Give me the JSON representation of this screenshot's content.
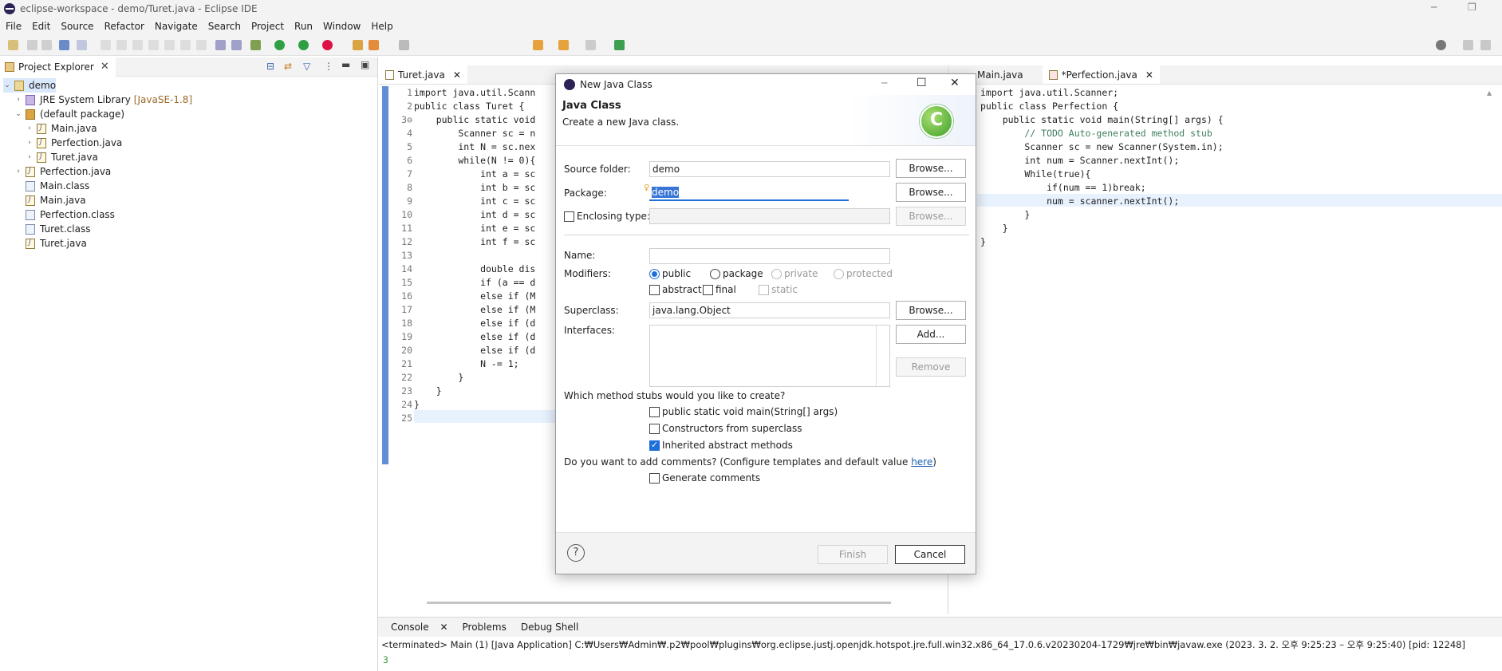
{
  "window": {
    "title": "eclipse-workspace - demo/Turet.java - Eclipse IDE",
    "minimize": "─",
    "maximize": "❐"
  },
  "menu": [
    "File",
    "Edit",
    "Source",
    "Refactor",
    "Navigate",
    "Search",
    "Project",
    "Run",
    "Window",
    "Help"
  ],
  "explorer": {
    "tab": "Project Explorer",
    "tree": [
      {
        "label": "demo",
        "icon": "project-icon",
        "twisty": "⌄",
        "indent": 0
      },
      {
        "label": "JRE System Library",
        "suffix": "[JavaSE-1.8]",
        "icon": "library-icon",
        "twisty": "›",
        "indent": 1
      },
      {
        "label": "(default package)",
        "icon": "package-icon",
        "twisty": "⌄",
        "indent": 1
      },
      {
        "label": "Main.java",
        "icon": "java-file-icon",
        "twisty": "›",
        "indent": 2
      },
      {
        "label": "Perfection.java",
        "icon": "java-file-icon",
        "twisty": "›",
        "indent": 2
      },
      {
        "label": "Turet.java",
        "icon": "java-file-icon",
        "twisty": "›",
        "indent": 2
      },
      {
        "label": "Perfection.java",
        "icon": "java-file-icon",
        "twisty": "›",
        "indent": 1
      },
      {
        "label": "Main.class",
        "icon": "class-file-icon",
        "twisty": "",
        "indent": 1
      },
      {
        "label": "Main.java",
        "icon": "java-file-icon",
        "twisty": "",
        "indent": 1
      },
      {
        "label": "Perfection.class",
        "icon": "class-file-icon",
        "twisty": "",
        "indent": 1
      },
      {
        "label": "Turet.class",
        "icon": "class-file-icon",
        "twisty": "",
        "indent": 1
      },
      {
        "label": "Turet.java",
        "icon": "java-file-icon",
        "twisty": "",
        "indent": 1
      }
    ]
  },
  "editor_left": {
    "tab": "Turet.java",
    "line_numbers": [
      "1",
      "2",
      "3⊖",
      "4",
      "5",
      "6",
      "7",
      "8",
      "9",
      "10",
      "11",
      "12",
      "13",
      "14",
      "15",
      "16",
      "17",
      "18",
      "19",
      "20",
      "21",
      "22",
      "23",
      "24",
      "25"
    ],
    "lines": [
      "import java.util.Scann",
      "public class Turet {",
      "    public static void",
      "        Scanner sc = n",
      "        int N = sc.nex",
      "        while(N != 0){",
      "            int a = sc",
      "            int b = sc",
      "            int c = sc",
      "            int d = sc",
      "            int e = sc",
      "            int f = sc",
      "",
      "            double dis",
      "            if (a == d",
      "            else if (M",
      "            else if (M",
      "            else if (d",
      "            else if (d",
      "            else if (d",
      "            N -= 1;",
      "        }",
      "    }",
      "}",
      ""
    ]
  },
  "editor_right": {
    "tabs": [
      "Main.java",
      "*Perfection.java"
    ],
    "lines": [
      "import java.util.Scanner;",
      "public class Perfection {",
      "    public static void main(String[] args) {",
      "        // TODO Auto-generated method stub",
      "        Scanner sc = new Scanner(System.in);",
      "        int num = Scanner.nextInt();",
      "        While(true){",
      "            if(num == 1)break;",
      "            num = scanner.nextInt();",
      "        }",
      "    }",
      "}"
    ]
  },
  "console": {
    "tabs": [
      "Console",
      "Problems",
      "Debug Shell"
    ],
    "status": "<terminated> Main (1) [Java Application] C:₩Users₩Admin₩.p2₩pool₩plugins₩org.eclipse.justj.openjdk.hotspot.jre.full.win32.x86_64_17.0.6.v20230204-1729₩jre₩bin₩javaw.exe  (2023. 3. 2. 오후 9:25:23 – 오후 9:25:40) [pid: 12248]",
    "output": "3"
  },
  "dialog": {
    "title": "New Java Class",
    "heading": "Java Class",
    "subheading": "Create a new Java class.",
    "source_folder_label": "Source folder:",
    "source_folder_value": "demo",
    "package_label": "Package:",
    "package_value": "demo",
    "enclosing_label": "Enclosing type:",
    "name_label": "Name:",
    "name_value": "",
    "modifiers_label": "Modifiers:",
    "modifiers": {
      "public": "public",
      "package": "package",
      "private": "private",
      "protected": "protected",
      "abstract": "abstract",
      "final": "final",
      "static": "static"
    },
    "superclass_label": "Superclass:",
    "superclass_value": "java.lang.Object",
    "interfaces_label": "Interfaces:",
    "browse": "Browse...",
    "add": "Add...",
    "remove": "Remove",
    "stubs_question": "Which method stubs would you like to create?",
    "stub_main": "public static void main(String[] args)",
    "stub_constructors": "Constructors from superclass",
    "stub_inherited": "Inherited abstract methods",
    "comments_question": "Do you want to add comments? (Configure templates and default value ",
    "comments_link": "here",
    "comments_close": ")",
    "generate_comments": "Generate comments",
    "help": "?",
    "finish": "Finish",
    "cancel": "Cancel",
    "minimize": "─",
    "maximize": "☐",
    "close": "✕"
  }
}
